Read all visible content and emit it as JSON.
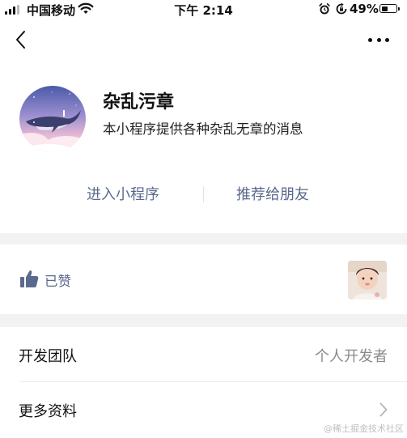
{
  "status_bar": {
    "carrier": "中国移动",
    "time": "下午 2:14",
    "battery_percent": "49%",
    "battery_level": 0.49
  },
  "nav": {
    "back_icon": "chevron-left-icon",
    "more_icon": "more-dots-icon"
  },
  "profile": {
    "name": "杂乱污章",
    "description": "本小程序提供各种杂乱无章的消息",
    "avatar": "whale-sky-avatar"
  },
  "actions": {
    "enter_label": "进入小程序",
    "recommend_label": "推荐给朋友"
  },
  "like": {
    "label": "已赞",
    "icon": "thumbs-up-icon"
  },
  "info": {
    "team_label": "开发团队",
    "team_value": "个人开发者",
    "more_label": "更多资料"
  },
  "watermark": "@稀土掘金技术社区",
  "colors": {
    "accent": "#5a6a8c",
    "background": "#f2f2f2",
    "card": "#ffffff"
  }
}
